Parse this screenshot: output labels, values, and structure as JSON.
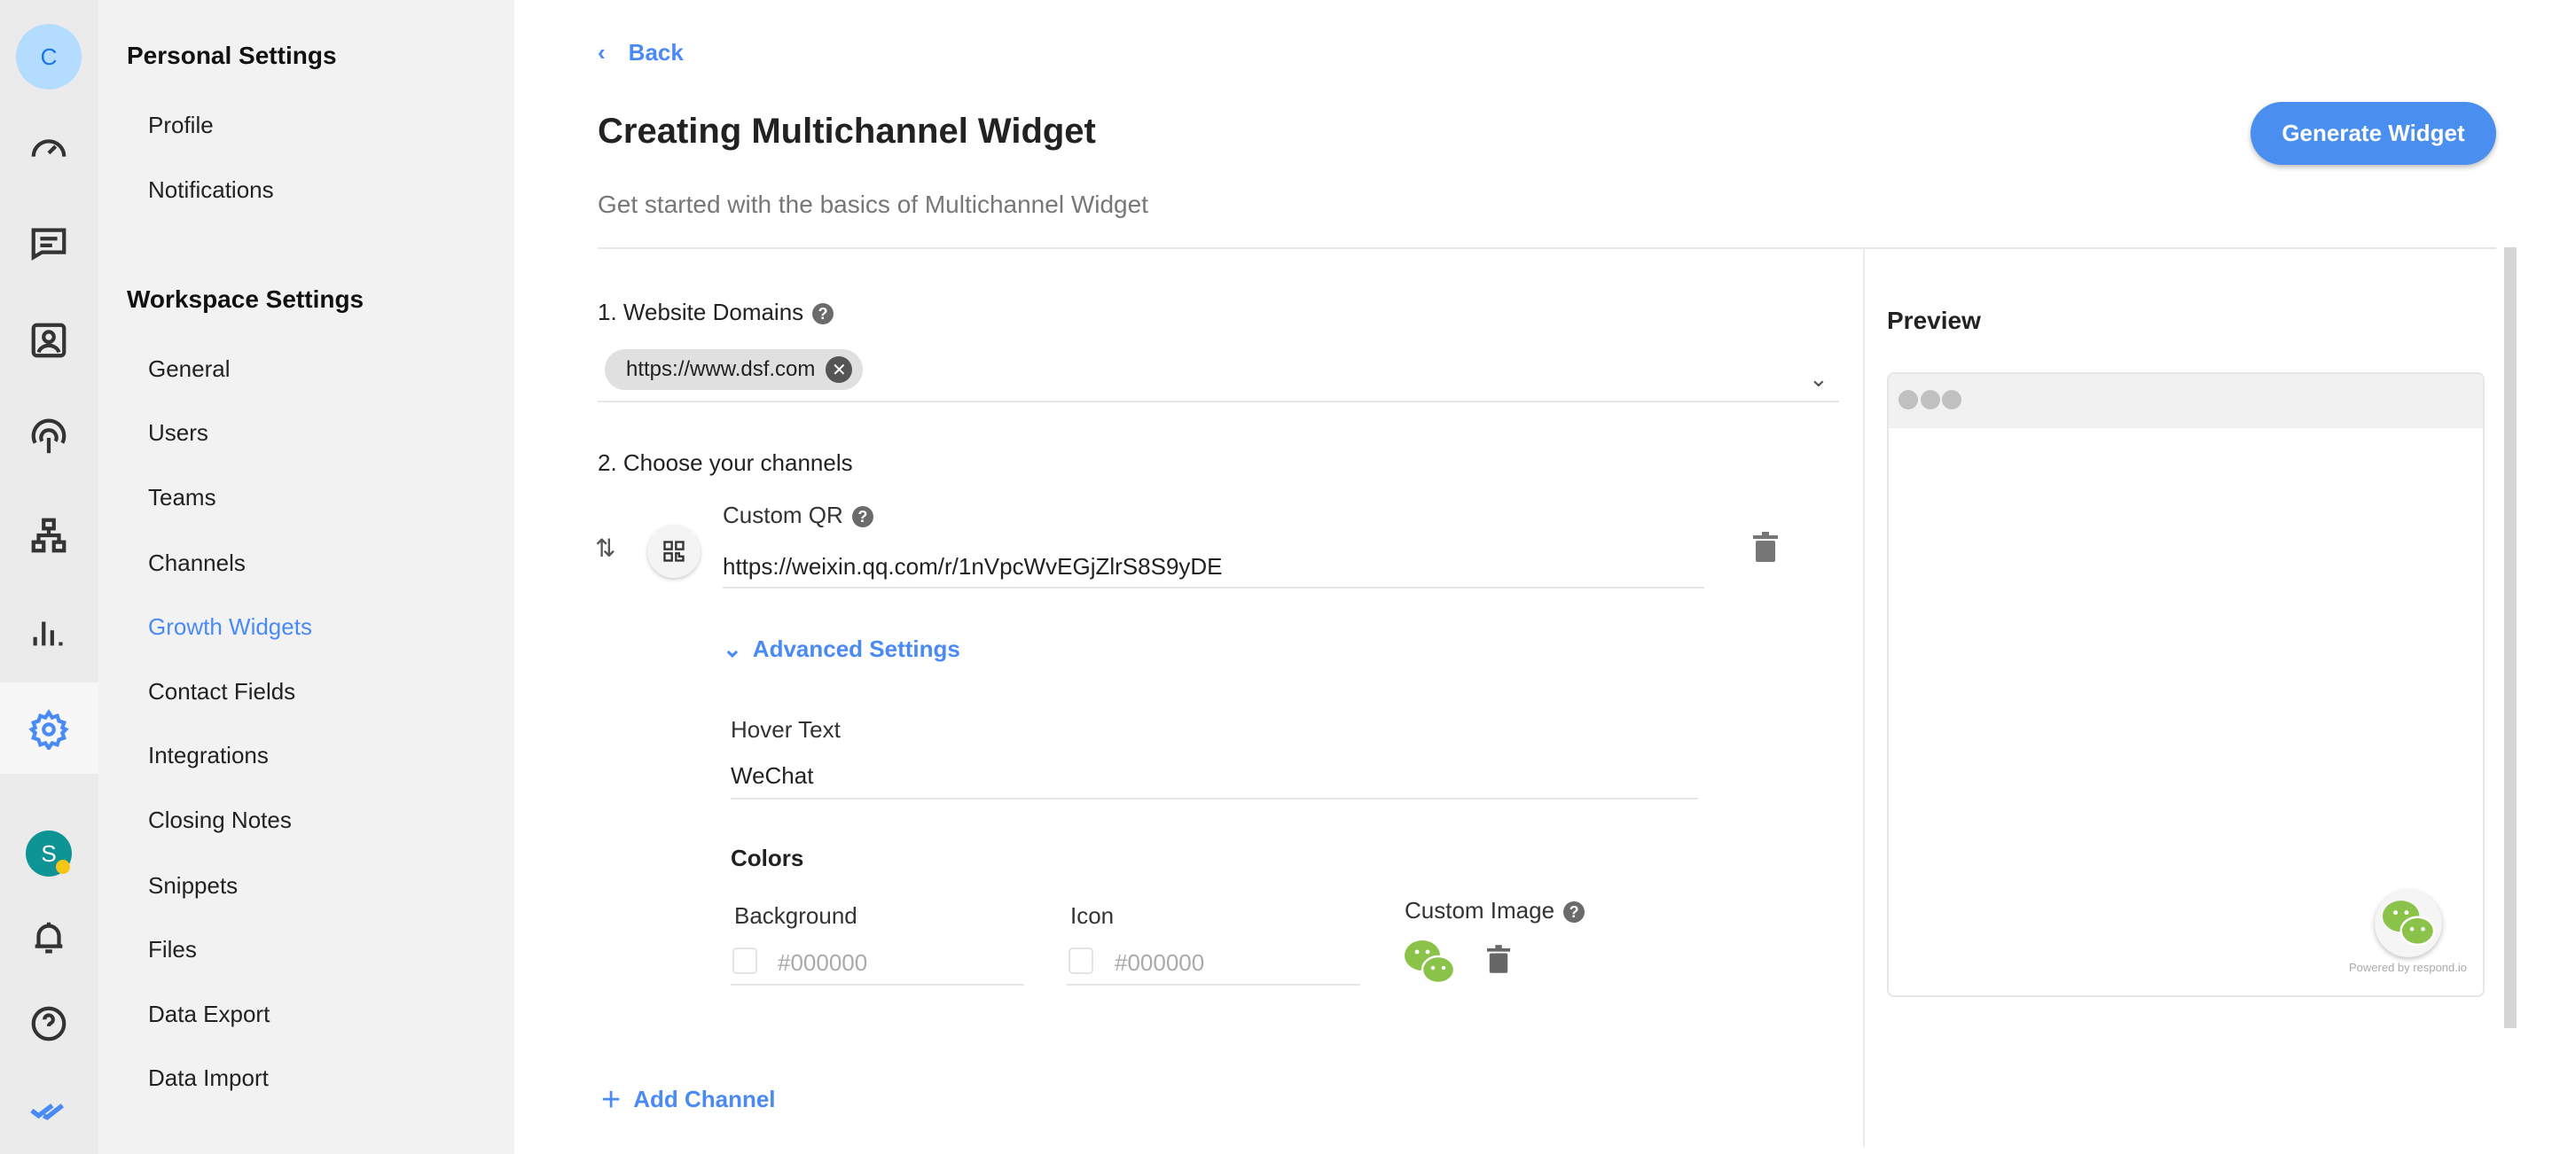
{
  "rail": {
    "avatar_letter": "C",
    "user_letter": "S",
    "icons": [
      "dashboard-icon",
      "messages-icon",
      "contacts-icon",
      "broadcast-icon",
      "workflows-icon",
      "reports-icon",
      "settings-icon"
    ]
  },
  "sidebar": {
    "personal_heading": "Personal Settings",
    "personal_items": [
      "Profile",
      "Notifications"
    ],
    "workspace_heading": "Workspace Settings",
    "workspace_items": [
      "General",
      "Users",
      "Teams",
      "Channels",
      "Growth Widgets",
      "Contact Fields",
      "Integrations",
      "Closing Notes",
      "Snippets",
      "Files",
      "Data Export",
      "Data Import"
    ],
    "active_item": "Growth Widgets"
  },
  "header": {
    "back_label": "Back",
    "title": "Creating Multichannel Widget",
    "subtitle": "Get started with the basics of Multichannel Widget",
    "generate_label": "Generate Widget"
  },
  "form": {
    "domains_label": "1. Website Domains",
    "domains": [
      "https://www.dsf.com"
    ],
    "channels_label": "2. Choose your channels",
    "channel": {
      "name": "Custom QR",
      "url": "https://weixin.qq.com/r/1nVpcWvEGjZlrS8S9yDE",
      "advanced_label": "Advanced Settings",
      "hover_text_label": "Hover Text",
      "hover_text_value": "WeChat",
      "colors_label": "Colors",
      "background_label": "Background",
      "background_placeholder": "#000000",
      "icon_label": "Icon",
      "icon_placeholder": "#000000",
      "custom_image_label": "Custom Image"
    },
    "add_channel_label": "Add Channel"
  },
  "preview": {
    "title": "Preview",
    "powered_by": "Powered by respond.io"
  },
  "colors": {
    "accent": "#4a8af4",
    "wechat": "#8bc34a",
    "avatar_bg": "#b3dcff",
    "user_avatar": "#0e9494",
    "status_dot": "#f5c518"
  }
}
